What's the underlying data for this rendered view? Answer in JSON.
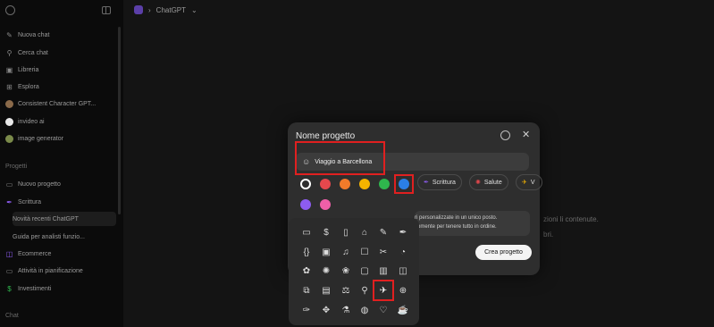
{
  "sidebar": {
    "items": [
      {
        "label": "Nuova chat",
        "icon": "edit-icon"
      },
      {
        "label": "Cerca chat",
        "icon": "search-icon"
      },
      {
        "label": "Libreria",
        "icon": "library-icon"
      },
      {
        "label": "Esplora",
        "icon": "grid-icon"
      },
      {
        "label": "Consistent Character GPT...",
        "icon": "gpt-avatar-icon"
      },
      {
        "label": "invideo ai",
        "icon": "gpt-avatar-icon"
      },
      {
        "label": "image generator",
        "icon": "gpt-avatar-icon"
      }
    ],
    "projects_label": "Progetti",
    "projects": [
      {
        "label": "Nuovo progetto",
        "icon": "folder-plus-icon"
      },
      {
        "label": "Scrittura",
        "icon": "pen-icon"
      }
    ],
    "subitems": [
      {
        "label": "Novità recenti ChatGPT"
      },
      {
        "label": "Guida per analisti funzio..."
      }
    ],
    "projects2": [
      {
        "label": "Ecommerce",
        "icon": "bag-icon"
      },
      {
        "label": "Attività in pianificazione",
        "icon": "folder-icon"
      },
      {
        "label": "Investimenti",
        "icon": "dollar-icon"
      }
    ],
    "chat_label": "Chat"
  },
  "header": {
    "title": "ChatGPT"
  },
  "background": {
    "line1": "zioni li contenute.",
    "line2": "bri."
  },
  "modal": {
    "title": "Nome progetto",
    "input_value": "Viaggio a Barcellona",
    "chips": [
      "Scrittura",
      "Salute",
      "V"
    ],
    "info_line1": "ri personalizzate in un unico posto.",
    "info_line2": "comente per tenere tutto in ordine.",
    "create_label": "Crea progetto",
    "colors": [
      "#ffffff",
      "#e5484d",
      "#f27b2a",
      "#f5b400",
      "#2fb64d",
      "#2b7fe6",
      "#8d5cf0",
      "#ef5fa8"
    ],
    "selected_color": "#2b7fe6"
  },
  "picker": {
    "icons": [
      [
        "folder-icon",
        "dollar-icon",
        "book-icon",
        "graduation-cap-icon",
        "pencil-icon",
        "pen-nib-icon"
      ],
      [
        "code-icon",
        "terminal-icon",
        "music-icon",
        "basket-icon",
        "tools-icon",
        "palette-icon"
      ],
      [
        "paw-icon",
        "gear-flower-icon",
        "lotus-icon",
        "briefcase-icon",
        "chart-icon",
        "mug-icon"
      ],
      [
        "dumbbell-icon",
        "document-icon",
        "scales-icon",
        "lightbulb-icon",
        "airplane-icon",
        "globe-icon"
      ],
      [
        "wrench-icon",
        "pawprint-icon",
        "flask-icon",
        "ball-icon",
        "heart-icon",
        "cup-icon"
      ]
    ],
    "glyphs": [
      [
        "▭",
        "$",
        "▯",
        "⌂",
        "✎",
        "✒"
      ],
      [
        "{}",
        "▣",
        "♫",
        "☐",
        "✂",
        "◔"
      ],
      [
        "✿",
        "✺",
        "❀",
        "▢",
        "▥",
        "◫"
      ],
      [
        "⧉",
        "▤",
        "⚖",
        "⚲",
        "✈",
        "⊕"
      ],
      [
        "✑",
        "✥",
        "⚗",
        "◍",
        "♡",
        "☕"
      ]
    ],
    "selected": "airplane-icon"
  }
}
